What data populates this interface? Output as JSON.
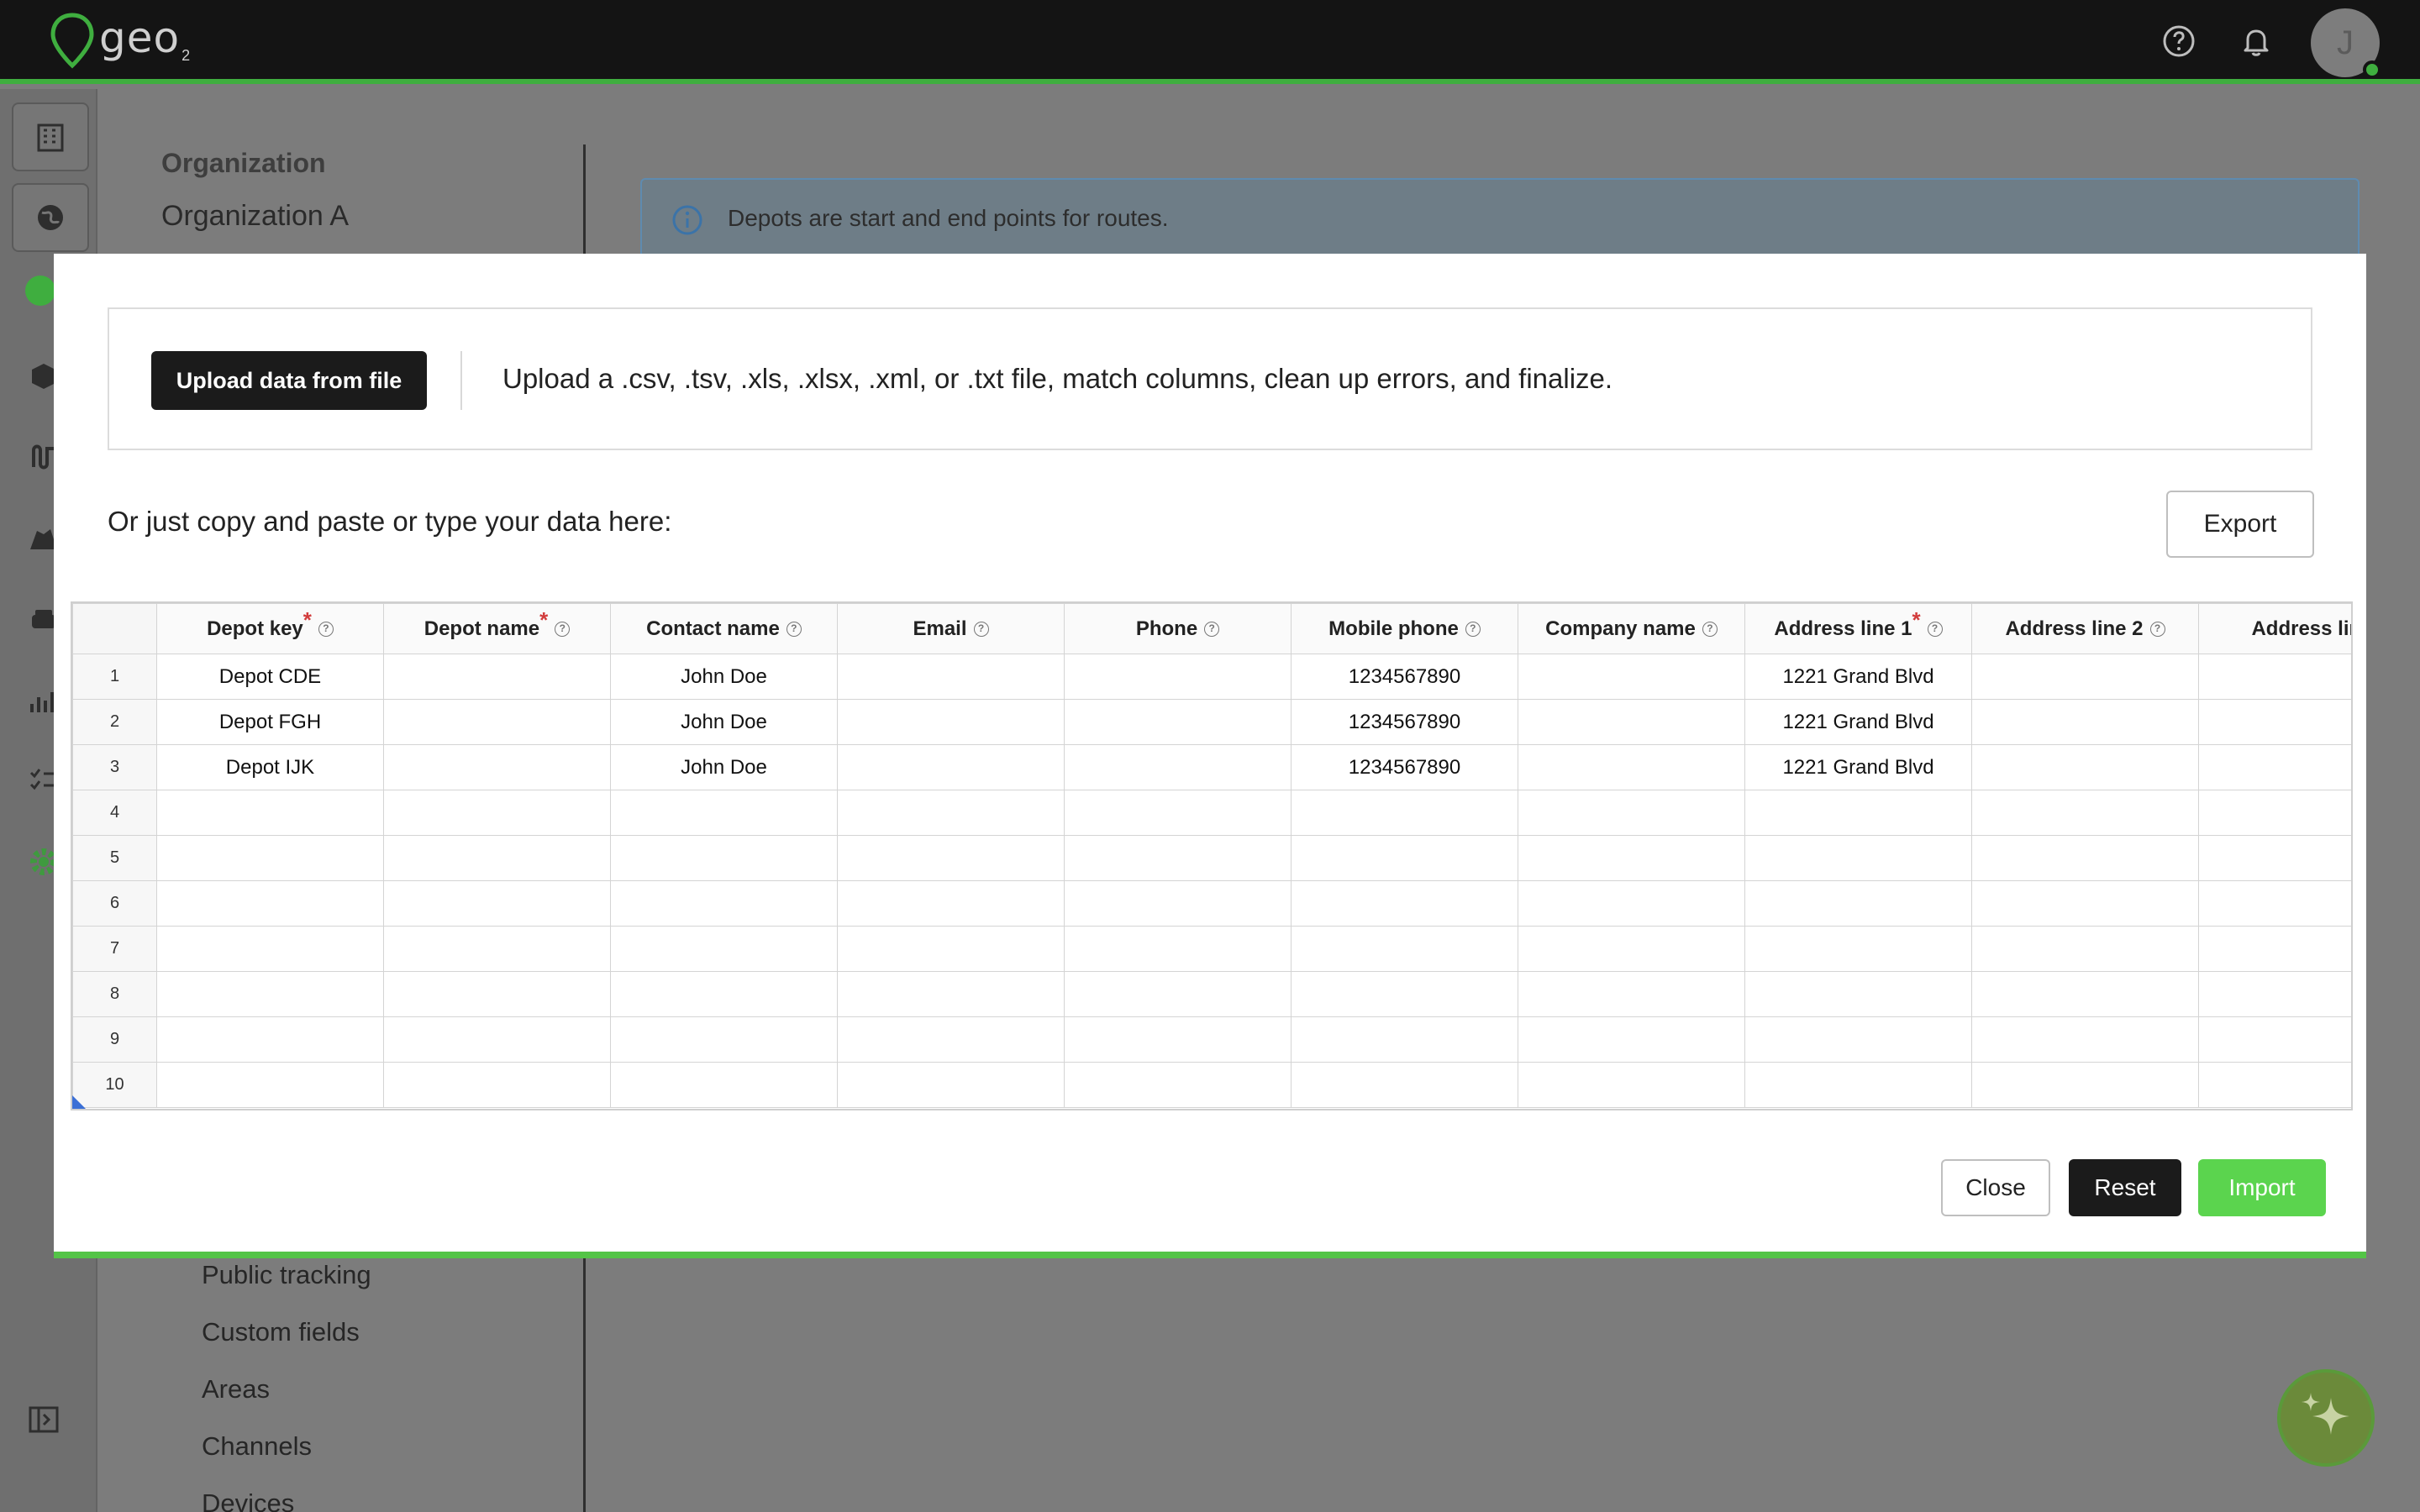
{
  "app": {
    "logo_text": "geo",
    "logo_sub": "2"
  },
  "header": {
    "help_icon": "help-circle-icon",
    "bell_icon": "bell-icon",
    "avatar_initial": "J",
    "accent_color": "#3fae3f"
  },
  "background": {
    "org_label": "Organization",
    "org_value": "Organization A",
    "info_text": "Depots are start and end points for routes.",
    "nav_items": [
      "Public tracking",
      "Custom fields",
      "Areas",
      "Channels",
      "Devices"
    ]
  },
  "modal": {
    "upload_button": "Upload data from file",
    "upload_description": "Upload a .csv, .tsv, .xls, .xlsx, .xml, or .txt file, match columns, clean up errors, and finalize.",
    "paste_text": "Or just copy and paste or type your data here:",
    "export_button": "Export",
    "close_button": "Close",
    "reset_button": "Reset",
    "import_button": "Import",
    "import_color": "#5bd44e"
  },
  "grid": {
    "columns": [
      {
        "label": "Depot key",
        "required": true
      },
      {
        "label": "Depot name",
        "required": true
      },
      {
        "label": "Contact name",
        "required": false
      },
      {
        "label": "Email",
        "required": false
      },
      {
        "label": "Phone",
        "required": false
      },
      {
        "label": "Mobile phone",
        "required": false
      },
      {
        "label": "Company name",
        "required": false
      },
      {
        "label": "Address line 1",
        "required": true
      },
      {
        "label": "Address line 2",
        "required": false
      },
      {
        "label": "Address line",
        "required": false
      }
    ],
    "rows": [
      [
        "Depot CDE",
        "",
        "John Doe",
        "",
        "",
        "1234567890",
        "",
        "1221 Grand Blvd",
        "",
        ""
      ],
      [
        "Depot FGH",
        "",
        "John Doe",
        "",
        "",
        "1234567890",
        "",
        "1221 Grand Blvd",
        "",
        ""
      ],
      [
        "Depot IJK",
        "",
        "John Doe",
        "",
        "",
        "1234567890",
        "",
        "1221 Grand Blvd",
        "",
        ""
      ],
      [
        "",
        "",
        "",
        "",
        "",
        "",
        "",
        "",
        "",
        ""
      ],
      [
        "",
        "",
        "",
        "",
        "",
        "",
        "",
        "",
        "",
        ""
      ],
      [
        "",
        "",
        "",
        "",
        "",
        "",
        "",
        "",
        "",
        ""
      ],
      [
        "",
        "",
        "",
        "",
        "",
        "",
        "",
        "",
        "",
        ""
      ],
      [
        "",
        "",
        "",
        "",
        "",
        "",
        "",
        "",
        "",
        ""
      ],
      [
        "",
        "",
        "",
        "",
        "",
        "",
        "",
        "",
        "",
        ""
      ],
      [
        "",
        "",
        "",
        "",
        "",
        "",
        "",
        "",
        "",
        ""
      ]
    ],
    "row_numbers": [
      "1",
      "2",
      "3",
      "4",
      "5",
      "6",
      "7",
      "8",
      "9",
      "10"
    ]
  }
}
